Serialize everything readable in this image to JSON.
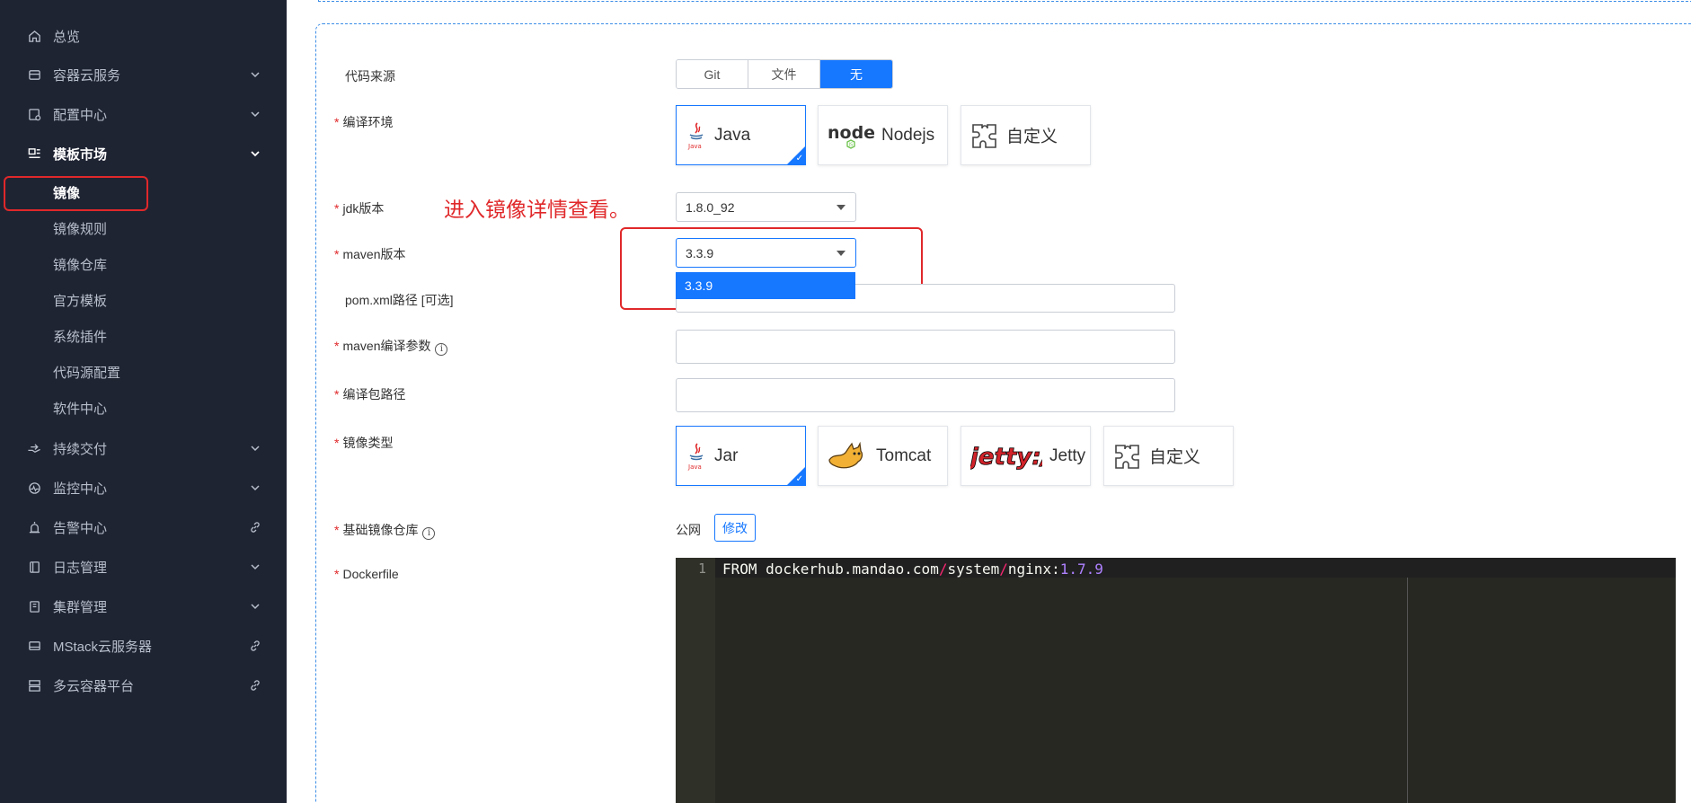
{
  "sidebar": {
    "items": [
      {
        "label": "总览",
        "icon": "home-icon"
      },
      {
        "label": "容器云服务",
        "icon": "box-icon",
        "arrow": "chevron-down"
      },
      {
        "label": "配置中心",
        "icon": "config-icon",
        "arrow": "chevron-down"
      },
      {
        "label": "模板市场",
        "icon": "template-icon",
        "arrow": "chevron-down"
      },
      {
        "label": "持续交付",
        "icon": "delivery-icon",
        "arrow": "chevron-down"
      },
      {
        "label": "监控中心",
        "icon": "monitor-icon",
        "arrow": "chevron-down"
      },
      {
        "label": "告警中心",
        "icon": "alarm-icon",
        "arrow": "link"
      },
      {
        "label": "日志管理",
        "icon": "log-icon",
        "arrow": "chevron-down"
      },
      {
        "label": "集群管理",
        "icon": "cluster-icon",
        "arrow": "chevron-down"
      },
      {
        "label": "MStack云服务器",
        "icon": "server-icon",
        "arrow": "link"
      },
      {
        "label": "多云容器平台",
        "icon": "multicloud-icon",
        "arrow": "link"
      }
    ],
    "sub_items": [
      {
        "label": "镜像"
      },
      {
        "label": "镜像规则"
      },
      {
        "label": "镜像仓库"
      },
      {
        "label": "官方模板"
      },
      {
        "label": "系统插件"
      },
      {
        "label": "代码源配置"
      },
      {
        "label": "软件中心"
      }
    ]
  },
  "form": {
    "code_source": {
      "label": "代码来源",
      "options": [
        "Git",
        "文件",
        "无"
      ],
      "selected": "无"
    },
    "compile_env": {
      "label": "编译环境",
      "options": [
        "Java",
        "Nodejs",
        "自定义"
      ],
      "selected": "Java"
    },
    "jdk": {
      "label": "jdk版本",
      "value": "1.8.0_92"
    },
    "maven": {
      "label": "maven版本",
      "value": "3.3.9",
      "dropdown_option": "3.3.9"
    },
    "pom": {
      "label": "pom.xml路径 [可选]"
    },
    "maven_params": {
      "label": "maven编译参数"
    },
    "package_path": {
      "label": "编译包路径"
    },
    "image_type": {
      "label": "镜像类型",
      "options": [
        "Jar",
        "Tomcat",
        "Jetty",
        "自定义"
      ],
      "selected": "Jar"
    },
    "base_repo": {
      "label": "基础镜像仓库",
      "value": "公网",
      "edit_label": "修改"
    },
    "dockerfile": {
      "label": "Dockerfile",
      "line_number": "1",
      "code_parts": [
        "FROM dockerhub.mandao.com",
        "/",
        "system",
        "/",
        "nginx:",
        "1.7.9"
      ]
    }
  },
  "annotation": {
    "text": "进入镜像详情查看。"
  },
  "colors": {
    "accent": "#1677ff",
    "sidebar_bg": "#1f2433",
    "annotation": "#e0282a"
  }
}
